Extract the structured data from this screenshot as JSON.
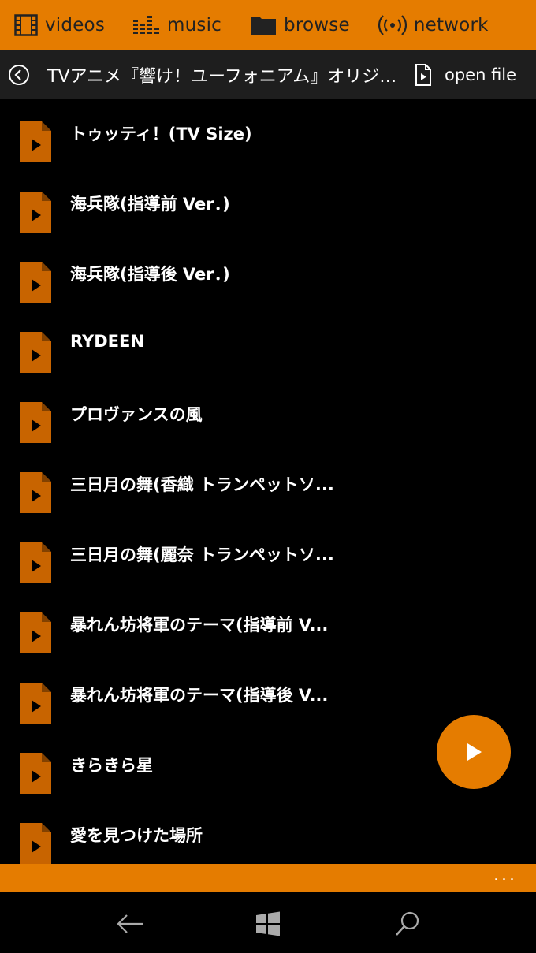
{
  "nav": {
    "items": [
      {
        "label": "videos",
        "icon": "film-icon"
      },
      {
        "label": "music",
        "icon": "equalizer-icon"
      },
      {
        "label": "browse",
        "icon": "folder-icon"
      },
      {
        "label": "network",
        "icon": "broadcast-icon"
      }
    ]
  },
  "header": {
    "title": "TVアニメ『響け！ユーフォニアム』オリジナルサ...",
    "open_file_label": "open file"
  },
  "files": [
    "トゥッティ！(TV Size)",
    "海兵隊(指導前 Ver．)",
    "海兵隊(指導後 Ver．)",
    "RYDEEN",
    "プロヴァンスの風",
    "三日月の舞(香織 トランペットソ...",
    "三日月の舞(麗奈 トランペットソ...",
    "暴れん坊将軍のテーマ(指導前 V...",
    "暴れん坊将軍のテーマ(指導後 V...",
    "きらきら星",
    "愛を見つけた場所"
  ],
  "minibar": {
    "more_label": "..."
  },
  "colors": {
    "accent": "#E57C00",
    "icon_fill": "#C86400",
    "header_bg": "#1e1e1e",
    "background": "#000000"
  }
}
